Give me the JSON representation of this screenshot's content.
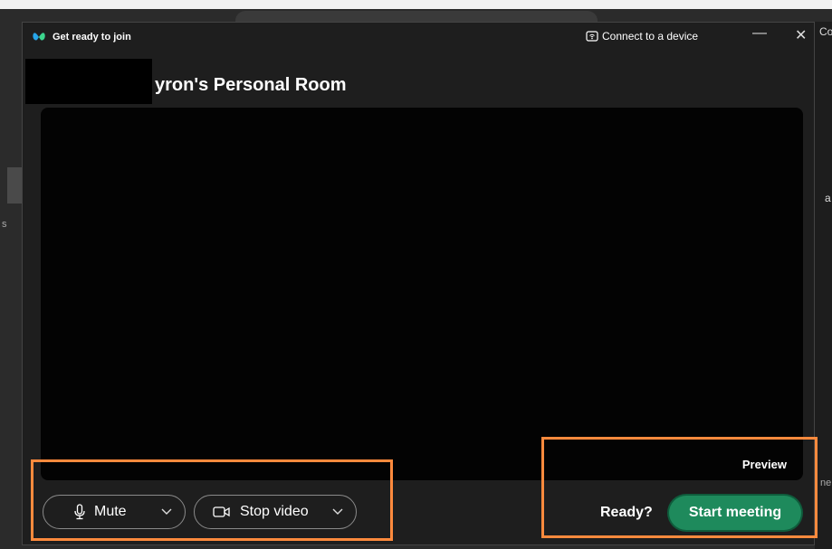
{
  "window": {
    "title": "Get ready to join",
    "connect_label": "Connect to a device",
    "minimize_glyph": "—",
    "close_glyph": "✕"
  },
  "room": {
    "title": "yron's Personal Room"
  },
  "preview": {
    "label": "Preview"
  },
  "controls": {
    "mute_label": "Mute",
    "stop_video_label": "Stop video",
    "ready_label": "Ready?",
    "start_meeting_label": "Start meeting"
  },
  "background_fragments": {
    "right_top": "Co",
    "right_mid": "a",
    "right_bottom": "ne",
    "left_mid": "s"
  },
  "icons": {
    "logo": "webex-logo-icon",
    "connect": "cast-device-icon",
    "mute": "microphone-icon",
    "video": "camera-icon",
    "dropdown": "chevron-down-icon"
  },
  "colors": {
    "dialog_bg": "#1e1e1e",
    "video_bg": "#030303",
    "start_button": "#1e8a5c",
    "highlight": "#ff8a3d"
  }
}
